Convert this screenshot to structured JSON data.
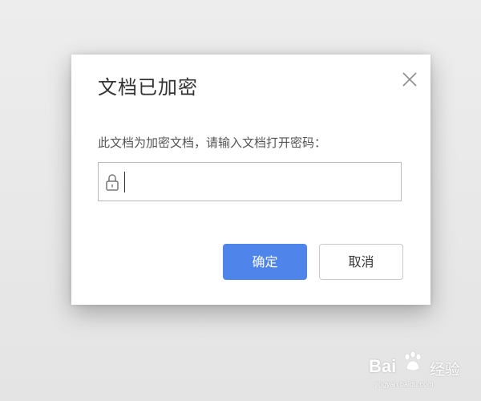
{
  "dialog": {
    "title": "文档已加密",
    "prompt": "此文档为加密文档，请输入文档打开密码：",
    "password": {
      "value": "",
      "placeholder": "",
      "icon": "lock-icon"
    },
    "close_icon": "close-icon",
    "ok_label": "确定",
    "cancel_label": "取消"
  },
  "watermark": {
    "brand": "Bai",
    "suffix": "经验",
    "url": "jingyan.baidu.com"
  },
  "colors": {
    "primary": "#4f85ea",
    "background": "#e7e7e7",
    "dialog": "#ffffff",
    "border": "#b9b9b9"
  }
}
